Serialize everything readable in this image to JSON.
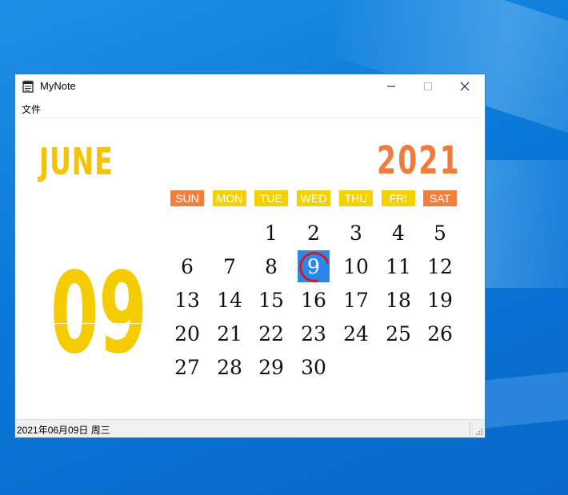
{
  "window": {
    "title": "MyNote",
    "minimize_icon": "minimize-icon",
    "maximize_icon": "maximize-icon",
    "close_icon": "close-icon",
    "app_icon": "notepad-icon"
  },
  "menubar": {
    "items": [
      {
        "label": "文件"
      }
    ]
  },
  "calendar": {
    "month_name": "JUNE",
    "year": "2021",
    "selected_day_big": "09",
    "weekdays": [
      {
        "label": "SUN",
        "color": "#f47f3c"
      },
      {
        "label": "MON",
        "color": "#f5d100"
      },
      {
        "label": "TUE",
        "color": "#f5d100"
      },
      {
        "label": "WED",
        "color": "#f5d100"
      },
      {
        "label": "THU",
        "color": "#f5d100"
      },
      {
        "label": "FRI",
        "color": "#f5d100"
      },
      {
        "label": "SAT",
        "color": "#f47f3c"
      }
    ],
    "days": [
      "1",
      "2",
      "3",
      "4",
      "5",
      "6",
      "7",
      "8",
      "9",
      "10",
      "11",
      "12",
      "13",
      "14",
      "15",
      "16",
      "17",
      "18",
      "19",
      "20",
      "21",
      "22",
      "23",
      "24",
      "25",
      "26",
      "27",
      "28",
      "29",
      "30"
    ],
    "first_weekday_index": 2,
    "selected_day": "9",
    "colors": {
      "month": "#f5c300",
      "year": "#ef7c3a",
      "big_day": "#f5cc00",
      "selected_bg": "#2f86ea",
      "selected_ring": "#d11b1b"
    }
  },
  "statusbar": {
    "text": "2021年06月09日 周三"
  }
}
